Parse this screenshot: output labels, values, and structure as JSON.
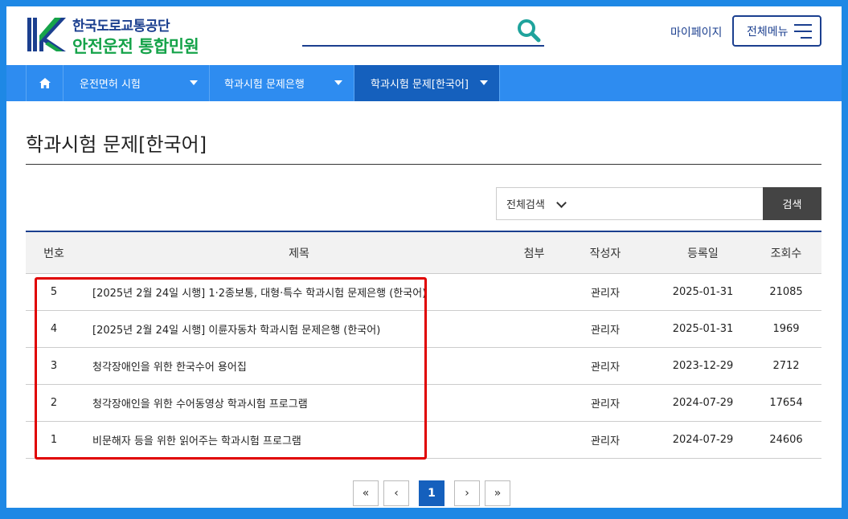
{
  "header": {
    "logo_line1": "한국도로교통공단",
    "logo_line2": "안전운전 통합민원",
    "mypage": "마이페이지",
    "all_menu": "전체메뉴"
  },
  "nav": {
    "items": [
      {
        "label": "운전면허 시험"
      },
      {
        "label": "학과시험 문제은행"
      },
      {
        "label": "학과시험 문제[한국어]"
      }
    ]
  },
  "page": {
    "title": "학과시험 문제[한국어]"
  },
  "search": {
    "scope": "전체검색",
    "button": "검색"
  },
  "table": {
    "headers": {
      "no": "번호",
      "title": "제목",
      "attach": "첨부",
      "author": "작성자",
      "date": "등록일",
      "views": "조회수"
    },
    "rows": [
      {
        "no": "5",
        "title": "[2025년 2월 24일 시행] 1·2종보통, 대형·특수 학과시험 문제은행 (한국어)",
        "author": "관리자",
        "date": "2025-01-31",
        "views": "21085"
      },
      {
        "no": "4",
        "title": "[2025년 2월 24일 시행] 이륜자동차 학과시험 문제은행 (한국어)",
        "author": "관리자",
        "date": "2025-01-31",
        "views": "1969"
      },
      {
        "no": "3",
        "title": "청각장애인을 위한 한국수어 용어집",
        "author": "관리자",
        "date": "2023-12-29",
        "views": "2712"
      },
      {
        "no": "2",
        "title": "청각장애인을 위한 수어동영상 학과시험 프로그램",
        "author": "관리자",
        "date": "2024-07-29",
        "views": "17654"
      },
      {
        "no": "1",
        "title": "비문해자 등을 위한 읽어주는 학과시험 프로그램",
        "author": "관리자",
        "date": "2024-07-29",
        "views": "24606"
      }
    ]
  },
  "pager": {
    "first": "«",
    "prev": "‹",
    "current": "1",
    "next": "›",
    "last": "»"
  },
  "colors": {
    "frame": "#1e88e5",
    "nav": "#2e8cf0",
    "nav_active": "#1560bd",
    "brand_navy": "#1b3f8f",
    "brand_green": "#16a34a",
    "highlight": "#e00000"
  }
}
